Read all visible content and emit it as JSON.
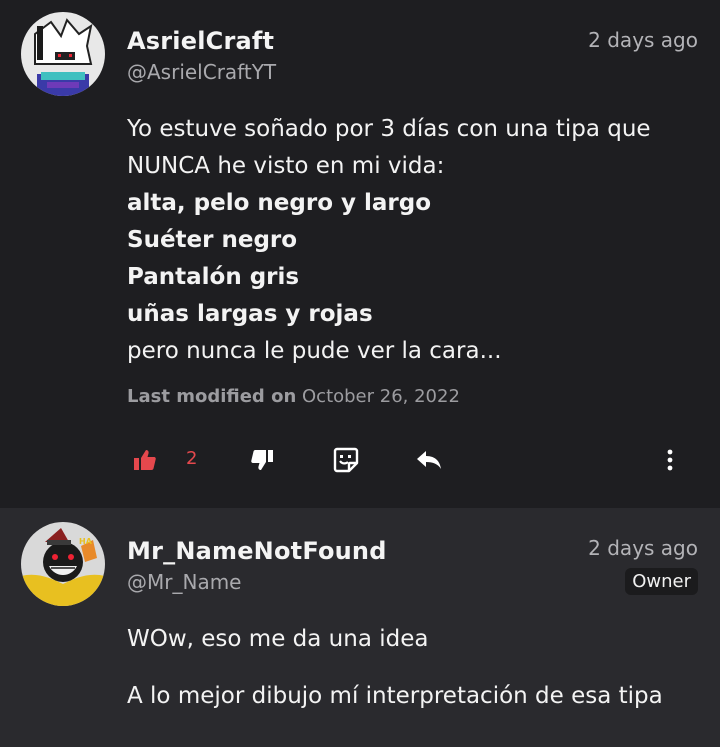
{
  "comments": [
    {
      "name": "AsrielCraft",
      "handle": "@AsrielCraftYT",
      "time": "2 days ago",
      "lines": [
        {
          "text": "Yo estuve soñado por 3 días con una tipa que",
          "bold": false
        },
        {
          "text": "NUNCA he visto en mi vida:",
          "bold": false
        },
        {
          "text": "alta, pelo negro y largo",
          "bold": true
        },
        {
          "text": "Suéter negro",
          "bold": true
        },
        {
          "text": "Pantalón gris",
          "bold": true
        },
        {
          "text": "uñas largas y rojas",
          "bold": true
        },
        {
          "text": "pero nunca le pude ver la cara...",
          "bold": false
        }
      ],
      "modified_label": "Last modified on",
      "modified_date": "October 26, 2022",
      "likes": "2"
    },
    {
      "name": "Mr_NameNotFound",
      "handle": "@Mr_Name",
      "time": "2 days ago",
      "badge": "Owner",
      "paragraph1": "WOw, eso me da una idea",
      "paragraph2": "A lo mejor dibujo mí interpretación de esa tipa"
    }
  ],
  "colors": {
    "accent_red": "#e5484d",
    "bg_first": "#1e1e21",
    "bg_second": "#2a2a2e"
  },
  "icons": [
    "thumbs-up-icon",
    "thumbs-down-icon",
    "sticker-icon",
    "reply-icon",
    "more-vertical-icon"
  ]
}
